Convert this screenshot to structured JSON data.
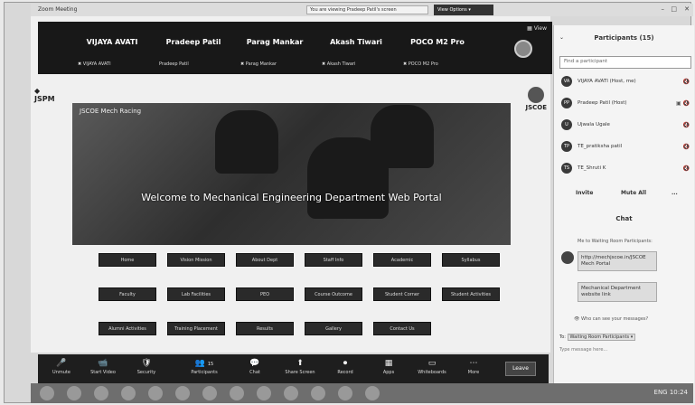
{
  "window": {
    "app_title": "Zoom Meeting",
    "view_info": "You are viewing Pradeep Patil's screen",
    "view_options": "View Options"
  },
  "participants_strip": {
    "view_label": "View",
    "tiles": [
      {
        "name": "VIJAYA AVATI",
        "sub": "VIJAYA AVATI"
      },
      {
        "name": "Pradeep Patil",
        "sub": "Pradeep Patil"
      },
      {
        "name": "Parag Mankar",
        "sub": "Parag Mankar"
      },
      {
        "name": "Akash Tiwari",
        "sub": "Akash Tiwari"
      },
      {
        "name": "POCO M2 Pro",
        "sub": "POCO M2 Pro"
      }
    ]
  },
  "portal": {
    "logo_left": "JSPM",
    "logo_right": "JSCOE",
    "banner_brand": "JSCOE Mech Racing",
    "welcome": "Welcome to Mechanical Engineering Department Web Portal",
    "nav_buttons": [
      "Home",
      "Vision Mission",
      "About Dept",
      "Staff Info",
      "Academic",
      "Syllabus",
      "Faculty",
      "Lab Facilities",
      "PEO",
      "Course Outcome",
      "Student Corner",
      "Student Activities",
      "Alumni Activities",
      "Training Placement",
      "Results",
      "Gallery",
      "Contact Us"
    ]
  },
  "toolbar": {
    "buttons": [
      {
        "icon": "🎤",
        "label": "Unmute"
      },
      {
        "icon": "📹",
        "label": "Start Video"
      },
      {
        "icon": "🛡",
        "label": "Security"
      },
      {
        "icon": "👥",
        "label": "Participants"
      },
      {
        "icon": "💬",
        "label": "Chat"
      },
      {
        "icon": "⬆",
        "label": "Share Screen"
      },
      {
        "icon": "⏺",
        "label": "Record"
      },
      {
        "icon": "▦",
        "label": "Apps"
      },
      {
        "icon": "▭",
        "label": "Whiteboards"
      },
      {
        "icon": "⋯",
        "label": "More"
      }
    ],
    "participants_count": "15",
    "leave_label": "Leave"
  },
  "panel": {
    "title": "Participants (15)",
    "search_placeholder": "Find a participant",
    "participants": [
      {
        "initials": "VA",
        "name": "VIJAYA AVATI (Host, me)"
      },
      {
        "initials": "PP",
        "name": "Pradeep Patil (Host)"
      },
      {
        "initials": "U",
        "name": "Ujwala Ugale"
      },
      {
        "initials": "TP",
        "name": "TE_pratiksha patil"
      },
      {
        "initials": "TS",
        "name": "TE_Shruti K"
      }
    ],
    "invite_label": "Invite",
    "mute_all_label": "Mute All",
    "more_label": "...",
    "chat_title": "Chat",
    "chat_from": "Me to Waiting Room Participants:",
    "messages": [
      "http://mechjscoe.in/JSCOE Mech Portal",
      "Mechanical Department website link"
    ],
    "who_can_see": "Who can see your messages?",
    "to_label": "To:",
    "to_target": "Waiting Room Participants",
    "type_placeholder": "Type message here..."
  },
  "taskbar": {
    "tray_text": "ENG 10:24"
  }
}
